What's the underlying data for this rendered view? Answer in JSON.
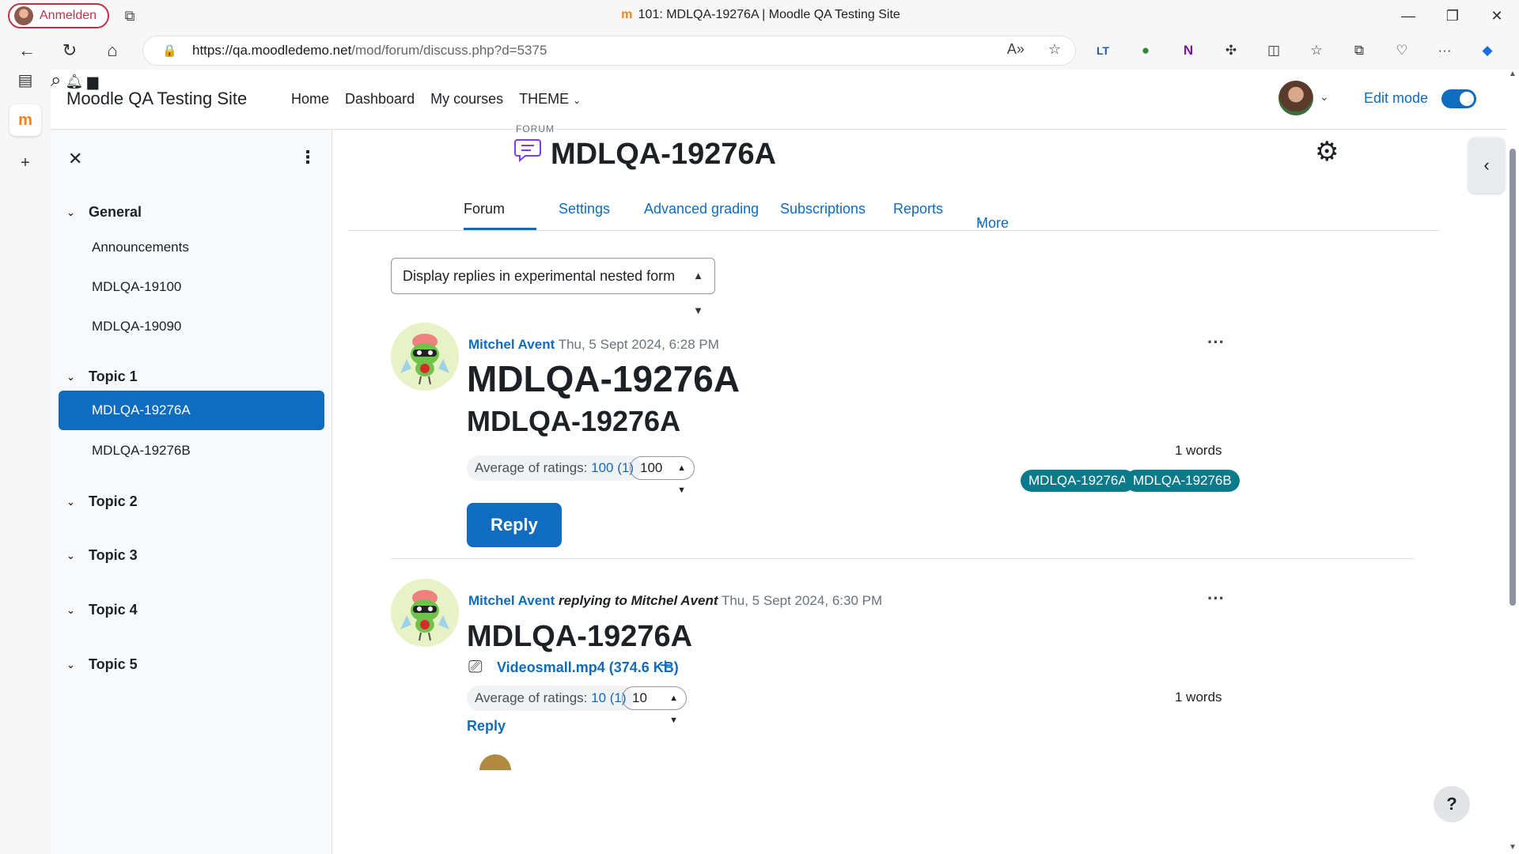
{
  "browser": {
    "profile_label": "Anmelden",
    "window_title": "101: MDLQA-19276A | Moodle QA Testing Site",
    "favicon_glyph": "m",
    "url_host": "https://qa.moodledemo.net",
    "url_path": "/mod/forum/discuss.php?d=5375",
    "win_controls": [
      "—",
      "❐",
      "✕"
    ],
    "ext_labels": [
      "LT"
    ],
    "copilot_glyph": "◆"
  },
  "navbar": {
    "site_name": "Moodle QA Testing Site",
    "links": [
      "Home",
      "Dashboard",
      "My courses",
      "THEME"
    ],
    "edit_mode_label": "Edit mode"
  },
  "drawer": {
    "sections": [
      {
        "title": "General",
        "activities": [
          "Announcements",
          "MDLQA-19100",
          "MDLQA-19090"
        ]
      },
      {
        "title": "Topic 1",
        "activities": [
          "MDLQA-19276A",
          "MDLQA-19276B"
        ]
      },
      {
        "title": "Topic 2",
        "activities": []
      },
      {
        "title": "Topic 3",
        "activities": []
      },
      {
        "title": "Topic 4",
        "activities": []
      },
      {
        "title": "Topic 5",
        "activities": []
      }
    ],
    "active_activity": "MDLQA-19276A"
  },
  "main": {
    "caption": "FORUM",
    "heading": "MDLQA-19276A",
    "tabs": [
      "Forum",
      "Settings",
      "Advanced grading",
      "Subscriptions",
      "Reports",
      "More"
    ],
    "active_tab": "Forum",
    "display_mode": "Display replies in experimental nested form"
  },
  "posts": [
    {
      "author": "Mitchel Avent",
      "date": "Thu, 5 Sept 2024, 6:28 PM",
      "subject": "MDLQA-19276A",
      "body": "MDLQA-19276A",
      "word_count": "1 words",
      "rating_label": "Average of ratings:",
      "rating_value": "100 (1)",
      "rating_select": "100",
      "tags": [
        "MDLQA-19276A",
        "MDLQA-19276B"
      ],
      "reply_label": "Reply"
    },
    {
      "author": "Mitchel Avent",
      "replying_text": "replying to Mitchel Avent",
      "date": "Thu, 5 Sept 2024, 6:30 PM",
      "subject": "MDLQA-19276A",
      "attachment": "Videosmall.mp4 (374.6 KB)",
      "word_count": "1 words",
      "rating_label": "Average of ratings:",
      "rating_value": "10 (1)",
      "rating_select": "10",
      "reply_label": "Reply"
    }
  ],
  "help_label": "?",
  "colors": {
    "primary": "#0f6cbf",
    "tag": "#0b7a8a",
    "forum_icon": "#7b3fe4",
    "moodle_orange": "#f98012"
  }
}
